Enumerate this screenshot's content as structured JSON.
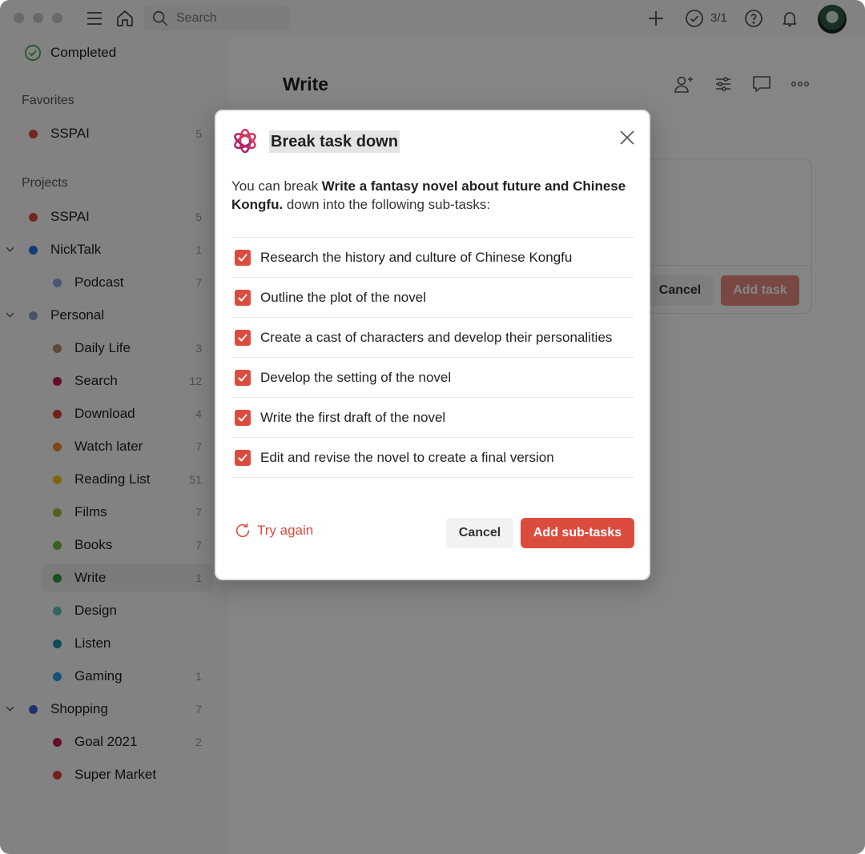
{
  "colors": {
    "accent": "#dc4c3e",
    "overlay": "rgba(0,0,0,0.48)"
  },
  "topbar": {
    "search_placeholder": "Search",
    "completed_count": "3/1",
    "icons": [
      "menu-icon",
      "home-icon",
      "search-icon",
      "add-icon",
      "check-circle-icon",
      "help-icon",
      "bell-icon",
      "avatar"
    ]
  },
  "sidebar": {
    "completed_label": "Completed",
    "favorites_heading": "Favorites",
    "favorites": [
      {
        "label": "SSPAI",
        "count": "5",
        "color": "#dc4c3e"
      }
    ],
    "projects_heading": "Projects",
    "projects": [
      {
        "label": "SSPAI",
        "count": "5",
        "color": "#dc4c3e"
      },
      {
        "label": "NickTalk",
        "count": "1",
        "color": "#1a73e8",
        "expandable": true
      },
      {
        "label": "Podcast",
        "count": "7",
        "color": "#8aa8e0",
        "indent": true
      },
      {
        "label": "Personal",
        "count": "",
        "color": "#8aa0c8",
        "expandable": true
      },
      {
        "label": "Daily Life",
        "count": "3",
        "color": "#b7866a",
        "indent": true
      },
      {
        "label": "Search",
        "count": "12",
        "color": "#c2185b",
        "indent": true
      },
      {
        "label": "Download",
        "count": "4",
        "color": "#d8402e",
        "indent": true
      },
      {
        "label": "Watch later",
        "count": "7",
        "color": "#f08c2a",
        "indent": true
      },
      {
        "label": "Reading List",
        "count": "51",
        "color": "#f3c21a",
        "indent": true
      },
      {
        "label": "Films",
        "count": "7",
        "color": "#a6b73e",
        "indent": true
      },
      {
        "label": "Books",
        "count": "7",
        "color": "#6dbb3e",
        "indent": true
      },
      {
        "label": "Write",
        "count": "1",
        "color": "#2e9c3e",
        "indent": true,
        "active": true
      },
      {
        "label": "Design",
        "count": "",
        "color": "#5fc2b2",
        "indent": true
      },
      {
        "label": "Listen",
        "count": "",
        "color": "#1b90a8",
        "indent": true
      },
      {
        "label": "Gaming",
        "count": "1",
        "color": "#2b9be8",
        "indent": true
      },
      {
        "label": "Shopping",
        "count": "7",
        "color": "#3f5bdf",
        "expandable": true
      },
      {
        "label": "Goal 2021",
        "count": "2",
        "color": "#c2185b",
        "indent": true
      },
      {
        "label": "Super Market",
        "count": "",
        "color": "#d8402e",
        "indent": true
      }
    ]
  },
  "main": {
    "title": "Write",
    "header_icons": [
      "share-icon",
      "view-options-icon",
      "comment-icon",
      "more-icon"
    ],
    "task_card": {
      "cancel_label": "Cancel",
      "add_label": "Add task"
    }
  },
  "modal": {
    "title": "Break task down",
    "desc_prefix": "You can break ",
    "desc_task": "Write a fantasy novel about future and Chinese Kongfu.",
    "desc_suffix": " down into the following sub-tasks:",
    "subtasks": [
      {
        "text": "Research the history and culture of Chinese Kongfu",
        "checked": true
      },
      {
        "text": "Outline the plot of the novel",
        "checked": true
      },
      {
        "text": "Create a cast of characters and develop their personalities",
        "checked": true
      },
      {
        "text": "Develop the setting of the novel",
        "checked": true
      },
      {
        "text": "Write the first draft of the novel",
        "checked": true
      },
      {
        "text": "Edit and revise the novel to create a final version",
        "checked": true
      }
    ],
    "try_again_label": "Try again",
    "cancel_label": "Cancel",
    "add_label": "Add sub-tasks"
  }
}
